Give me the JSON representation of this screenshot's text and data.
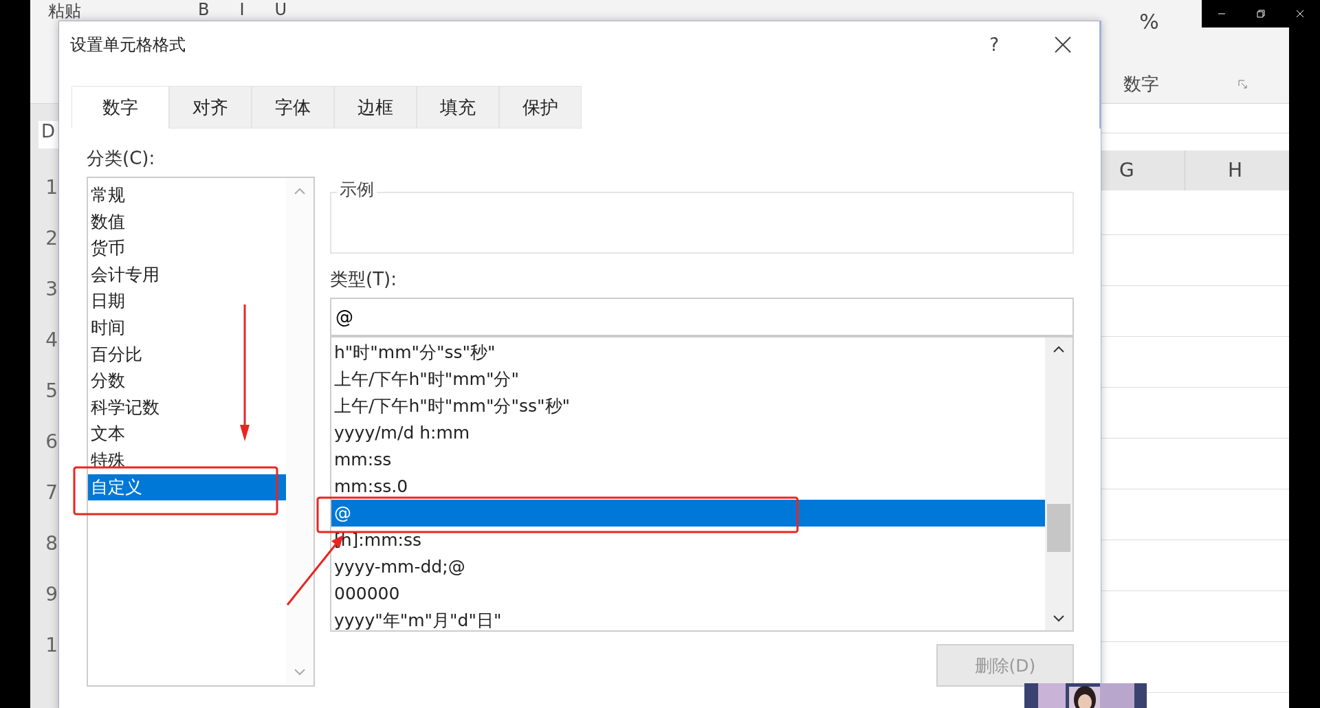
{
  "excel": {
    "ribbon_labels": [
      "粘贴",
      "B",
      "I",
      "U",
      "%"
    ],
    "name_box": "D",
    "group_label": "数字",
    "column_headers": [
      "G",
      "H"
    ],
    "row_headers": [
      "1",
      "2",
      "3",
      "4",
      "5",
      "6",
      "7",
      "8",
      "9",
      "1"
    ]
  },
  "dialog": {
    "title": "设置单元格格式",
    "help": "?"
  },
  "tabs": [
    {
      "label": "数字",
      "selected": true
    },
    {
      "label": "对齐",
      "selected": false
    },
    {
      "label": "字体",
      "selected": false
    },
    {
      "label": "边框",
      "selected": false
    },
    {
      "label": "填充",
      "selected": false
    },
    {
      "label": "保护",
      "selected": false
    }
  ],
  "category_label": "分类(C):",
  "categories": [
    {
      "label": "常规",
      "selected": false
    },
    {
      "label": "数值",
      "selected": false
    },
    {
      "label": "货币",
      "selected": false
    },
    {
      "label": "会计专用",
      "selected": false
    },
    {
      "label": "日期",
      "selected": false
    },
    {
      "label": "时间",
      "selected": false
    },
    {
      "label": "百分比",
      "selected": false
    },
    {
      "label": "分数",
      "selected": false
    },
    {
      "label": "科学记数",
      "selected": false
    },
    {
      "label": "文本",
      "selected": false
    },
    {
      "label": "特殊",
      "selected": false
    },
    {
      "label": "自定义",
      "selected": true
    }
  ],
  "sample_label": "示例",
  "type_label": "类型(T):",
  "type_value": "@",
  "types": [
    {
      "label": "h\"时\"mm\"分\"ss\"秒\"",
      "selected": false
    },
    {
      "label": "上午/下午h\"时\"mm\"分\"",
      "selected": false
    },
    {
      "label": "上午/下午h\"时\"mm\"分\"ss\"秒\"",
      "selected": false
    },
    {
      "label": "yyyy/m/d h:mm",
      "selected": false
    },
    {
      "label": "mm:ss",
      "selected": false
    },
    {
      "label": "mm:ss.0",
      "selected": false
    },
    {
      "label": "@",
      "selected": true
    },
    {
      "label": "[h]:mm:ss",
      "selected": false
    },
    {
      "label": "yyyy-mm-dd;@",
      "selected": false
    },
    {
      "label": "000000",
      "selected": false
    },
    {
      "label": "yyyy\"年\"m\"月\"d\"日\"",
      "selected": false
    }
  ],
  "delete_button": {
    "label": "删除(D)",
    "disabled": true
  }
}
